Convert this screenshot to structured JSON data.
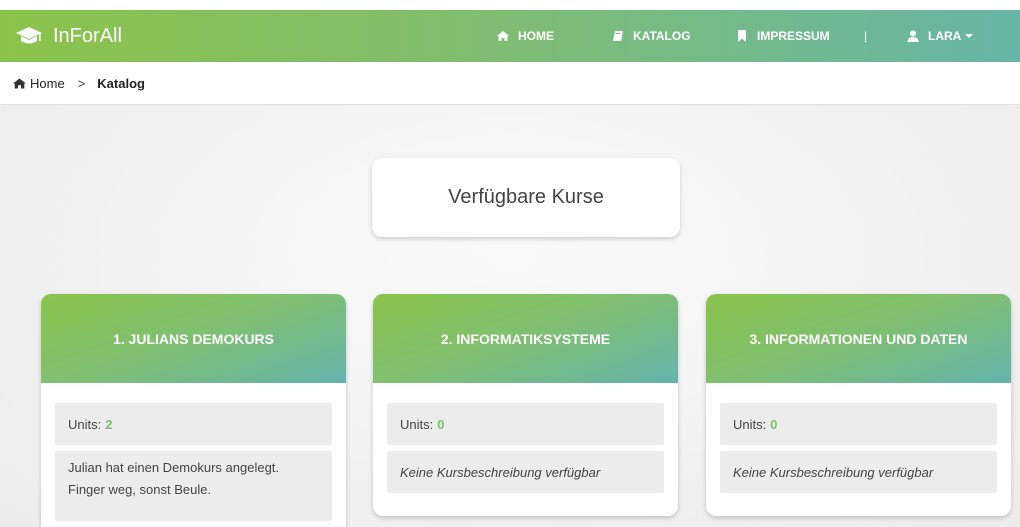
{
  "navbar": {
    "brand": "InForAll",
    "items": [
      {
        "label": "HOME",
        "icon": "home-icon"
      },
      {
        "label": "KATALOG",
        "icon": "book-icon"
      },
      {
        "label": "IMPRESSUM",
        "icon": "bookmark-icon"
      }
    ],
    "separator": "|",
    "user": {
      "label": "LARA",
      "icon": "user-icon"
    }
  },
  "breadcrumb": {
    "home": "Home",
    "separator": ">",
    "current": "Katalog"
  },
  "main": {
    "title": "Verfügbare Kurse",
    "courses": [
      {
        "title": "1. JULIANS DEMOKURS",
        "units_label": "Units:",
        "units": "2",
        "description": "Julian hat einen Demokurs angelegt. Finger weg, sonst Beule."
      },
      {
        "title": "2. INFORMATIKSYSTEME",
        "units_label": "Units:",
        "units": "0",
        "description": "Keine Kursbeschreibung verfügbar"
      },
      {
        "title": "3. INFORMATIONEN UND DATEN",
        "units_label": "Units:",
        "units": "0",
        "description": "Keine Kursbeschreibung verfügbar"
      }
    ]
  },
  "colors": {
    "gradient_start": "#8bc34a",
    "gradient_end": "#66b5a6",
    "units_accent": "#7cc06e"
  }
}
